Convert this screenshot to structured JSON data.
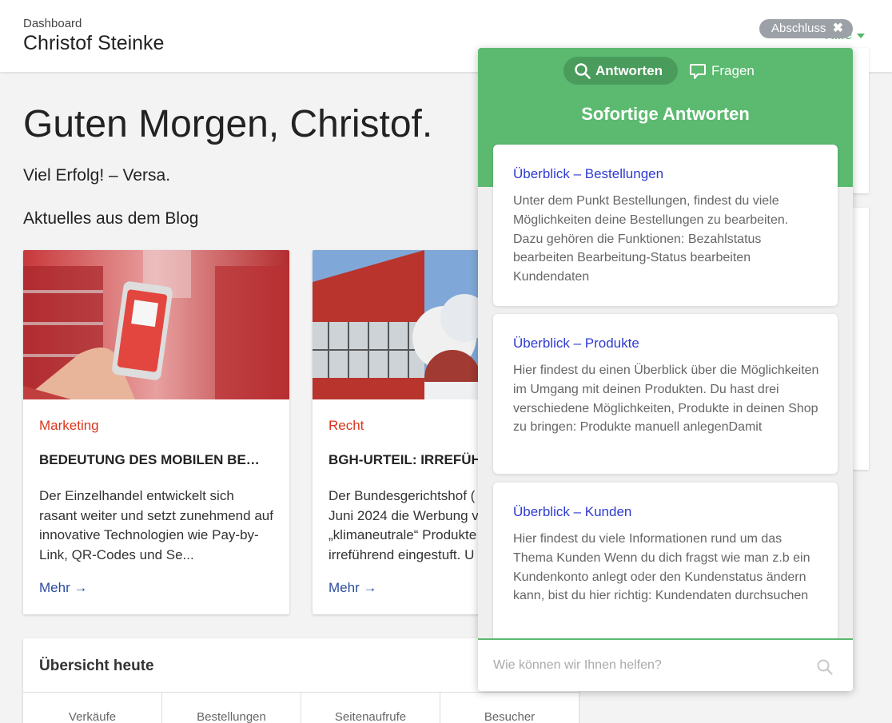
{
  "header": {
    "eyebrow": "Dashboard",
    "user_name": "Christof Steinke",
    "help_label": "Hilfe",
    "close_pill_label": "Abschluss",
    "close_pill_icon": "close-icon"
  },
  "main": {
    "greeting": "Guten Morgen, Christof.",
    "subline": "Viel Erfolg! – Versa.",
    "blog_heading": "Aktuelles aus dem Blog",
    "cards": [
      {
        "category": "Marketing",
        "title": "BEDEUTUNG DES MOBILEN BE…",
        "excerpt": "Der Einzelhandel entwickelt sich rasant weiter und setzt zunehmend auf innovative Technologien wie Pay-by-Link, QR-Codes und Se...",
        "more": "Mehr"
      },
      {
        "category": "Recht",
        "title": "BGH-URTEIL: IRREFÜH",
        "excerpt": "Der Bundesgerichtshof ( Juni 2024 die Werbung v „klimaneutrale“ Produkte irreführend eingestuft. U",
        "more": "Mehr"
      }
    ],
    "overview": {
      "title": "Übersicht heute",
      "columns": [
        "Verkäufe",
        "Bestellungen",
        "Seitenaufrufe",
        "Besucher"
      ]
    }
  },
  "help_panel": {
    "tabs": [
      {
        "label": "Antworten",
        "icon": "search-icon",
        "active": true
      },
      {
        "label": "Fragen",
        "icon": "chat-bubble-icon",
        "active": false
      }
    ],
    "heading": "Sofortige Antworten",
    "articles": [
      {
        "title": "Überblick – Bestellungen",
        "text": "Unter dem Punkt Bestellungen, findest du viele Möglichkeiten deine Bestellungen zu bearbeiten. Dazu gehören die Funktionen: Bezahlstatus bearbeiten Bearbeitung-Status bearbeiten Kundendaten"
      },
      {
        "title": "Überblick – Produkte",
        "text": "Hier findest du einen Überblick über die Möglichkeiten im Umgang mit deinen Produkten. Du hast drei verschiedene Möglichkeiten, Produkte in deinen Shop zu bringen: Produkte manuell anlegenDamit"
      },
      {
        "title": "Überblick – Kunden",
        "text": "Hier findest du viele Informationen rund um das Thema Kunden Wenn du dich fragst wie man z.b ein Kundenkonto anlegt oder den Kundenstatus ändern kann, bist du hier richtig: Kundendaten durchsuchen"
      }
    ],
    "search_placeholder": "Wie können wir Ihnen helfen?"
  },
  "colors": {
    "brand_green": "#5bba6f",
    "brand_green_dark": "#4a9c5c",
    "category_red": "#d9361e",
    "link_blue": "#2c4d9e",
    "article_title_blue": "#2f3ad1"
  }
}
